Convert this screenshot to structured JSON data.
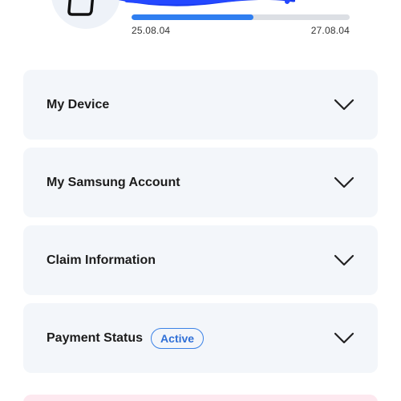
{
  "plan": {
    "start_date": "25.08.04",
    "end_date": "27.08.04",
    "progress": 0.56
  },
  "cards": [
    {
      "title": "My Device"
    },
    {
      "title": "My Samsung Account"
    },
    {
      "title": "Claim Information"
    },
    {
      "title": "Payment Status",
      "badge": "Active"
    }
  ],
  "colors": {
    "accent": "#2f7ef0",
    "card_bg": "#f3f6fa",
    "badge_border": "#3b82e6",
    "bottom_strip": "#fde8ef"
  },
  "icons": {
    "device": "phone-icon",
    "expand": "chevron-down-icon"
  }
}
